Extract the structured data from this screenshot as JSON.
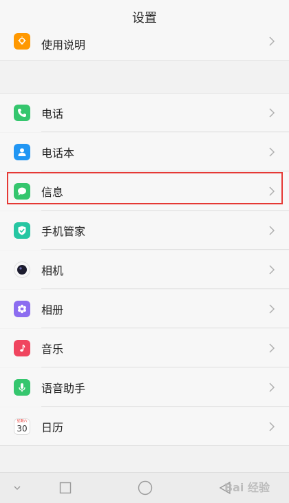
{
  "header": {
    "title": "设置"
  },
  "items": [
    {
      "label": "使用说明",
      "icon": "lightbulb-icon",
      "color": "#ff9800"
    },
    {
      "label": "电话",
      "icon": "phone-icon",
      "color": "#35c66e"
    },
    {
      "label": "电话本",
      "icon": "contacts-icon",
      "color": "#2196f3"
    },
    {
      "label": "信息",
      "icon": "message-icon",
      "color": "#35c66e"
    },
    {
      "label": "手机管家",
      "icon": "shield-icon",
      "color": "#26c6a2"
    },
    {
      "label": "相机",
      "icon": "camera-icon",
      "color": "#1c1c2e"
    },
    {
      "label": "相册",
      "icon": "gallery-icon",
      "color": "#8c6df0"
    },
    {
      "label": "音乐",
      "icon": "music-icon",
      "color": "#f0455f"
    },
    {
      "label": "语音助手",
      "icon": "microphone-icon",
      "color": "#35c66e"
    },
    {
      "label": "日历",
      "icon": "calendar-icon",
      "color": "#e53935"
    }
  ],
  "calendar_icon": {
    "day": "30",
    "weekday": "星期六"
  },
  "watermark": {
    "text": "Bai 经验"
  },
  "accent": {
    "highlight": "#e53935"
  }
}
